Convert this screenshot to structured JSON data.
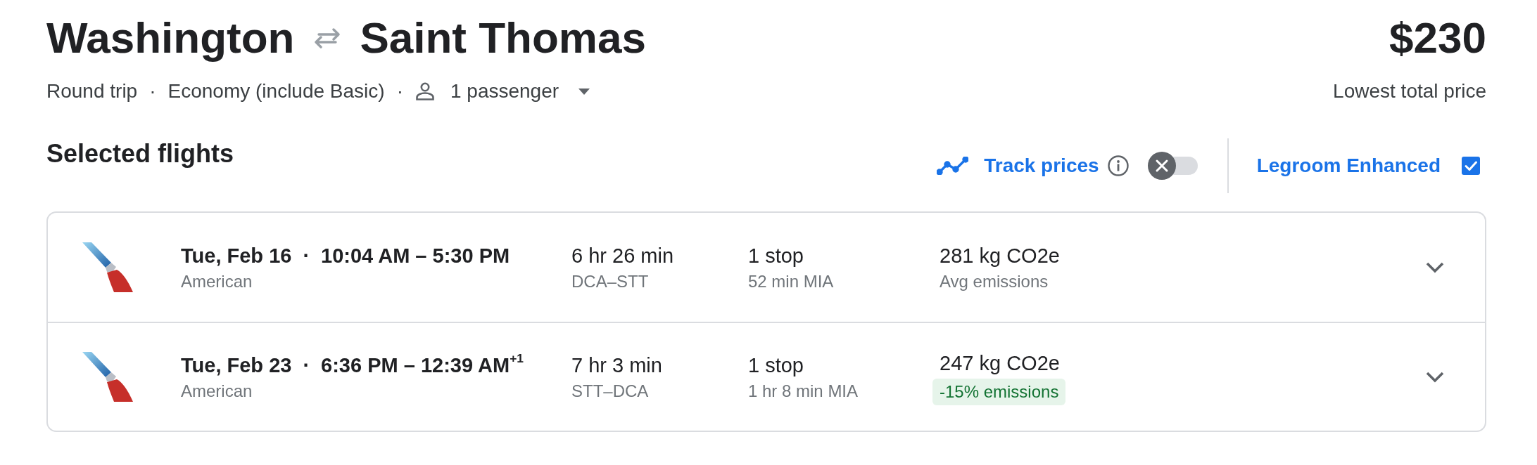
{
  "route": {
    "origin": "Washington",
    "destination": "Saint Thomas"
  },
  "price": {
    "amount": "$230",
    "label": "Lowest total price"
  },
  "trip_options": [
    {
      "kind": "text",
      "label": "Round trip"
    },
    {
      "kind": "separator",
      "label": "·"
    },
    {
      "kind": "text",
      "label": "Economy (include Basic)"
    },
    {
      "kind": "separator",
      "label": "·"
    },
    {
      "kind": "passengers",
      "label": "1 passenger"
    }
  ],
  "section_title": "Selected flights",
  "track_prices": {
    "label": "Track prices",
    "on": false
  },
  "legroom_filter": {
    "label": "Legroom Enhanced",
    "checked": true
  },
  "flights": [
    {
      "date": "Tue, Feb 16",
      "separator": "·",
      "times": "10:04 AM – 5:30 PM",
      "airline": "American",
      "duration": "6 hr 26 min",
      "route": "DCA–STT",
      "stops": "1 stop",
      "layover": "52 min MIA",
      "emissions": "281 kg CO2e",
      "emissions_note": {
        "kind": "plain",
        "text": "Avg emissions"
      },
      "expanded": false
    },
    {
      "date": "Tue, Feb 23",
      "separator": "·",
      "times": "6:36 PM – 12:39 AM$^{+1}$",
      "airline": "American",
      "duration": "7 hr 3 min",
      "route": "STT–DCA",
      "stops": "1 stop",
      "layover": "1 hr 8 min MIA",
      "emissions": "247 kg CO2e",
      "emissions_note": {
        "kind": "badge",
        "text": "-15% emissions"
      },
      "expanded": false
    }
  ]
}
